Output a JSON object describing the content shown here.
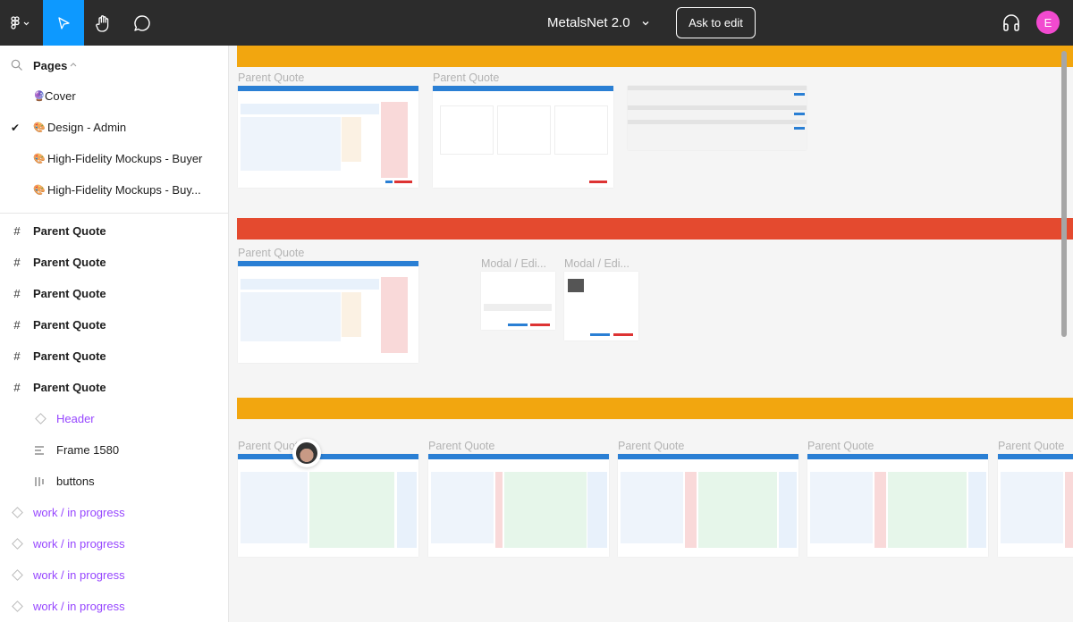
{
  "topbar": {
    "file_title": "MetalsNet 2.0",
    "ask_to_edit": "Ask to edit",
    "avatar_initial": "E",
    "avatar_color": "#f24ad0",
    "active_tool_color": "#0d99ff",
    "tools": [
      "figma-menu",
      "move",
      "hand",
      "comment"
    ]
  },
  "sidebar": {
    "pages_label": "Pages",
    "pages": [
      {
        "emoji": "🔮",
        "label": "Cover",
        "selected": false
      },
      {
        "emoji": "🎨",
        "label": "Design - Admin",
        "selected": true
      },
      {
        "emoji": "🎨",
        "label": "High-Fidelity Mockups - Buyer",
        "selected": false
      },
      {
        "emoji": "🎨",
        "label": "High-Fidelity Mockups - Buy...",
        "selected": false
      }
    ],
    "layers": [
      {
        "type": "frame",
        "label": "Parent Quote"
      },
      {
        "type": "frame",
        "label": "Parent Quote"
      },
      {
        "type": "frame",
        "label": "Parent Quote"
      },
      {
        "type": "frame",
        "label": "Parent Quote"
      },
      {
        "type": "frame",
        "label": "Parent Quote"
      },
      {
        "type": "frame",
        "label": "Parent Quote"
      },
      {
        "type": "component-child",
        "label": "Header"
      },
      {
        "type": "autolayout-child",
        "label": "Frame 1580"
      },
      {
        "type": "autolayout-h-child",
        "label": "buttons"
      },
      {
        "type": "component",
        "label": "work / in progress"
      },
      {
        "type": "component",
        "label": "work / in progress"
      },
      {
        "type": "component",
        "label": "work / in progress"
      },
      {
        "type": "component",
        "label": "work / in progress"
      }
    ]
  },
  "canvas": {
    "section_colors": {
      "orange": "#f2a60f",
      "red": "#e44a2f"
    },
    "frame_labels": {
      "row1": [
        "Parent Quote",
        "Parent Quote"
      ],
      "row2": [
        "Parent Quote",
        "Modal / Edi...",
        "Modal / Edi..."
      ],
      "row3": [
        "Parent Quote",
        "Parent Quote",
        "Parent Quote",
        "Parent Quote",
        "Parent Quote"
      ]
    }
  }
}
